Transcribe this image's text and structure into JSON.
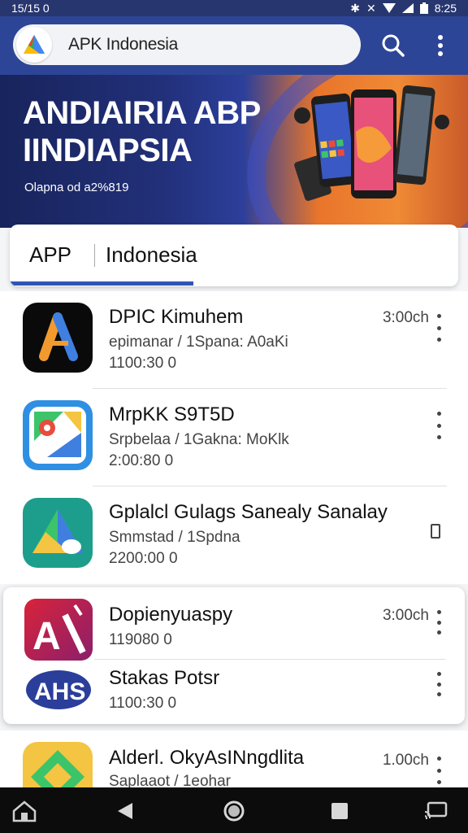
{
  "status_bar": {
    "time_left": "15/15 0",
    "time_right": "8:25"
  },
  "app_bar": {
    "title": "APK Indonesia"
  },
  "banner": {
    "headline": "ANDIAIRIA ABP\nIINDIAPSIA",
    "subline": "Olapna od a2%819"
  },
  "tabs": {
    "first": "APP",
    "second": "Indonesia"
  },
  "apps": [
    {
      "name": "DPIC Kimuhem",
      "meta": "epimanar / 1Spana: A0aKi",
      "size": "1100:30 0",
      "time": "3:00ch",
      "icon": "a-logo-icon"
    },
    {
      "name": "MrpKK S9T5D",
      "meta": "Srpbelaa / 1Gakna: MoKlk",
      "size": "2:00:80 0",
      "time": "",
      "icon": "maps-logo-icon"
    },
    {
      "name": "Gplalcl Gulags Sanealy Sanalay",
      "meta": "Smmstad / 1Spdna",
      "size": "2200:00 0",
      "time": "",
      "icon": "triangle-logo-icon"
    },
    {
      "name": "Dopienyuaspy",
      "size": "119080 0",
      "time": "3:00ch",
      "icon": "red-a-logo-icon"
    },
    {
      "name": "Stakas Potsr",
      "size": "1100:30 0",
      "time": "",
      "icon": "ahs-logo-icon"
    },
    {
      "name": "Alderl. OkyAsINngdlita",
      "meta": "Saplaaot / 1eohar",
      "time": "1.00ch",
      "icon": "green-logo-icon"
    }
  ],
  "colors": {
    "appbar": "#2d4596",
    "accent": "#2f56b5"
  }
}
